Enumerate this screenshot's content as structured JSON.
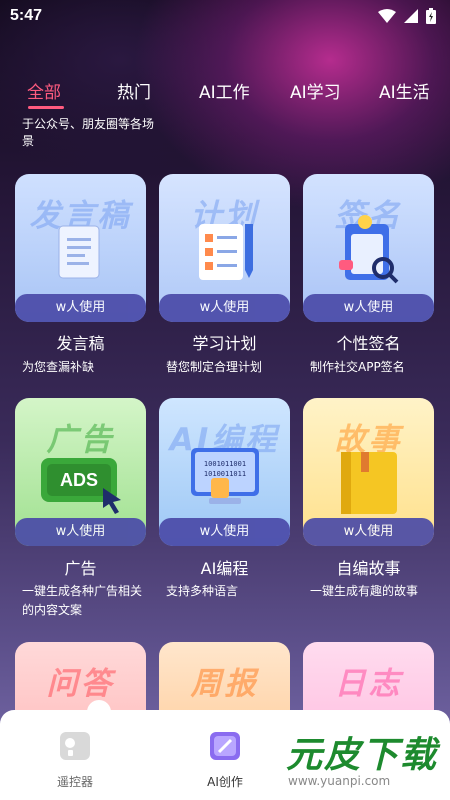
{
  "status_bar": {
    "time": "5:47"
  },
  "tabs": [
    {
      "label": "全部",
      "active": true
    },
    {
      "label": "热门"
    },
    {
      "label": "AI工作"
    },
    {
      "label": "AI学习"
    },
    {
      "label": "AI生活"
    }
  ],
  "top_description": "于公众号、朋友圈等各场景",
  "cards": [
    {
      "art_text": "发言稿",
      "usage": "w人使用",
      "title": "发言稿",
      "desc": "为您查漏补缺",
      "icon": "document-icon",
      "bg": "#cfe0ff"
    },
    {
      "art_text": "计划",
      "usage": "w人使用",
      "title": "学习计划",
      "desc": "替您制定合理计划",
      "icon": "checklist-pencil-icon",
      "bg": "#d6e4ff"
    },
    {
      "art_text": "签名",
      "usage": "w人使用",
      "title": "个性签名",
      "desc": "制作社交APP签名",
      "icon": "signature-clipboard-icon",
      "bg": "#d2e2ff"
    },
    {
      "art_text": "广告",
      "usage": "w人使用",
      "title": "广告",
      "desc": "一键生成各种广告相关的内容文案",
      "icon": "ads-screen-icon",
      "bg": "#cff3c4"
    },
    {
      "art_text": "AI编程",
      "usage": "w人使用",
      "title": "AI编程",
      "desc": "支持多种语言",
      "icon": "coding-monitor-icon",
      "bg": "#cfe6ff"
    },
    {
      "art_text": "故事",
      "usage": "w人使用",
      "title": "自编故事",
      "desc": "一键生成有趣的故事",
      "icon": "book-icon",
      "bg": "#fff1c4"
    },
    {
      "art_text": "问答",
      "icon": "qa-bubble-icon",
      "bg": "#ffd9d9"
    },
    {
      "art_text": "周报",
      "icon": "report-icon",
      "bg": "#ffe2c7"
    },
    {
      "art_text": "日志",
      "icon": "diary-icon",
      "bg": "#ffd9ef"
    }
  ],
  "bottom_nav": [
    {
      "label": "遥控器",
      "icon": "remote-icon"
    },
    {
      "label": "AI创作",
      "icon": "ai-create-icon",
      "active": true
    }
  ],
  "watermark": {
    "title": "元皮下载",
    "url": "www.yuanpi.com"
  },
  "colors": {
    "accent": "#ff5b7f",
    "usage_bar": "#4a4aa8",
    "watermark_green": "#1d8a2e"
  }
}
